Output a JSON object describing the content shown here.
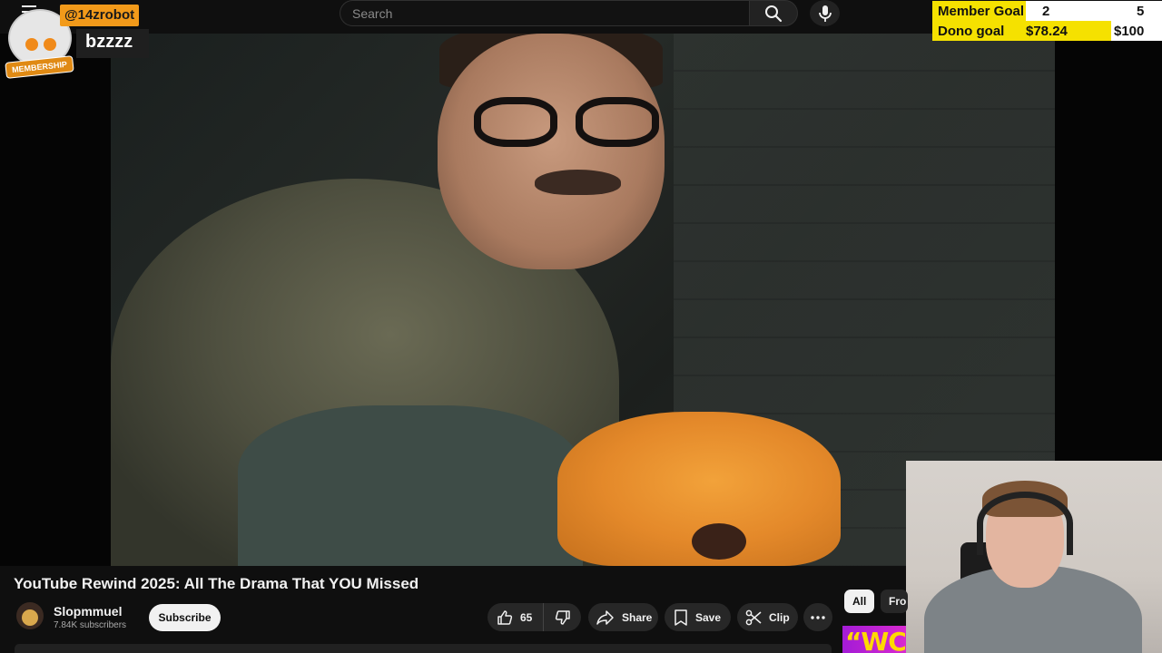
{
  "search": {
    "placeholder": "Search"
  },
  "goals": {
    "member": {
      "label": "Member Goal",
      "current": "2",
      "target": "5",
      "progress": 0.4
    },
    "dono": {
      "label": "Dono goal",
      "current": "$78.24",
      "target": "$100",
      "progress": 0.7824
    }
  },
  "chat_member": {
    "handle": "@14zrobot",
    "message": "bzzzz",
    "badge": "MEMBERSHIP"
  },
  "video": {
    "title": "YouTube Rewind 2025: All The Drama That YOU Missed",
    "channel": "Slopmmuel",
    "subscribers": "7.84K subscribers",
    "subscribe_label": "Subscribe",
    "likes": "65",
    "share_label": "Share",
    "save_label": "Save",
    "clip_label": "Clip"
  },
  "chips": {
    "all": "All",
    "from": "Fro"
  },
  "thumb_text": "“WC",
  "icons": [
    "menu-icon",
    "search-icon",
    "mic-icon",
    "thumbs-up-icon",
    "thumbs-down-icon",
    "share-icon",
    "bookmark-icon",
    "scissors-icon",
    "more-icon"
  ],
  "colors": {
    "goal_fill": "#f5e100",
    "member_handle_bg": "#f29a1a",
    "subscribe_bg": "#f1f1f1"
  }
}
